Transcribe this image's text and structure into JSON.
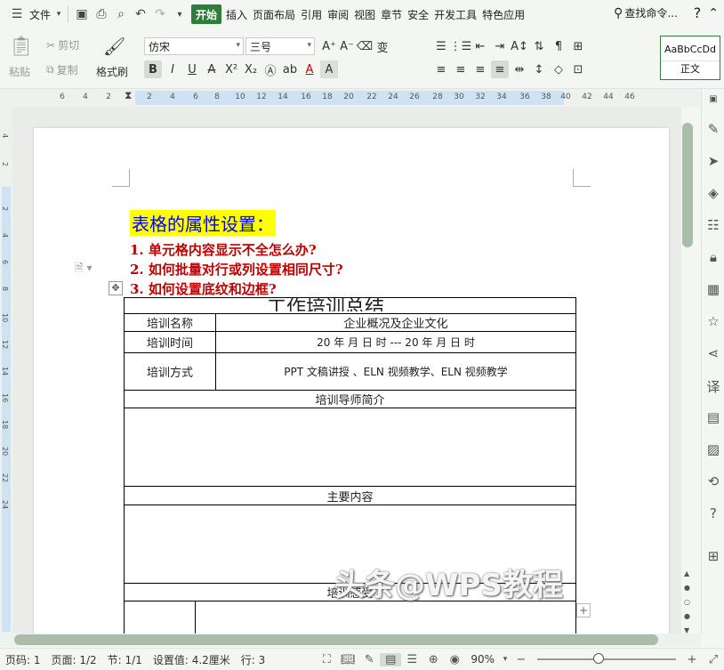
{
  "menubar": {
    "file": "文件",
    "tabs": [
      "开始",
      "插入",
      "页面布局",
      "引用",
      "审阅",
      "视图",
      "章节",
      "安全",
      "开发工具",
      "特色应用"
    ],
    "active_tab": "开始",
    "search": "查找命令...",
    "help": "?"
  },
  "ribbon": {
    "paste": "粘贴",
    "cut": "剪切",
    "copy": "复制",
    "format_painter": "格式刷",
    "font_name": "仿宋",
    "font_size": "三号",
    "style_preview": "AaBbCcDd",
    "style_name": "正文"
  },
  "ruler": {
    "ticks": [
      "6",
      "4",
      "2",
      "2",
      "4",
      "6",
      "8",
      "10",
      "12",
      "14",
      "16",
      "18",
      "20",
      "22",
      "24",
      "26",
      "28",
      "30",
      "32",
      "34",
      "36",
      "38",
      "40",
      "42",
      "44",
      "46"
    ],
    "vticks": [
      "4",
      "2",
      "2",
      "4",
      "6",
      "8",
      "10",
      "12",
      "14",
      "16",
      "18",
      "20",
      "22",
      "24"
    ]
  },
  "document": {
    "heading": "表格的属性设置：",
    "questions": [
      "1. 单元格内容显示不全怎么办?",
      "2. 如何批量对行或列设置相同尺寸?",
      "3. 如何设置底纹和边框?"
    ],
    "table_title": "工作培训总结",
    "rows": {
      "name_label": "培训名称",
      "name_value": "企业概况及企业文化",
      "time_label": "培训时间",
      "time_value": "20   年     月   日     时 ---  20    年     月   日     时",
      "method_label": "培训方式",
      "method_value": "PPT 文稿讲授   、ELN 视频教学、ELN 视频教学",
      "teacher": "培训导师简介",
      "content": "主要内容",
      "partial": "培训感受"
    },
    "watermark": "头条@WPS教程"
  },
  "status": {
    "page_num": "页码: 1",
    "pages": "页面: 1/2",
    "section": "节: 1/1",
    "setting": "设置值: 4.2厘米",
    "row": "行: 3",
    "zoom": "90%",
    "zoom_level": 0.42
  }
}
